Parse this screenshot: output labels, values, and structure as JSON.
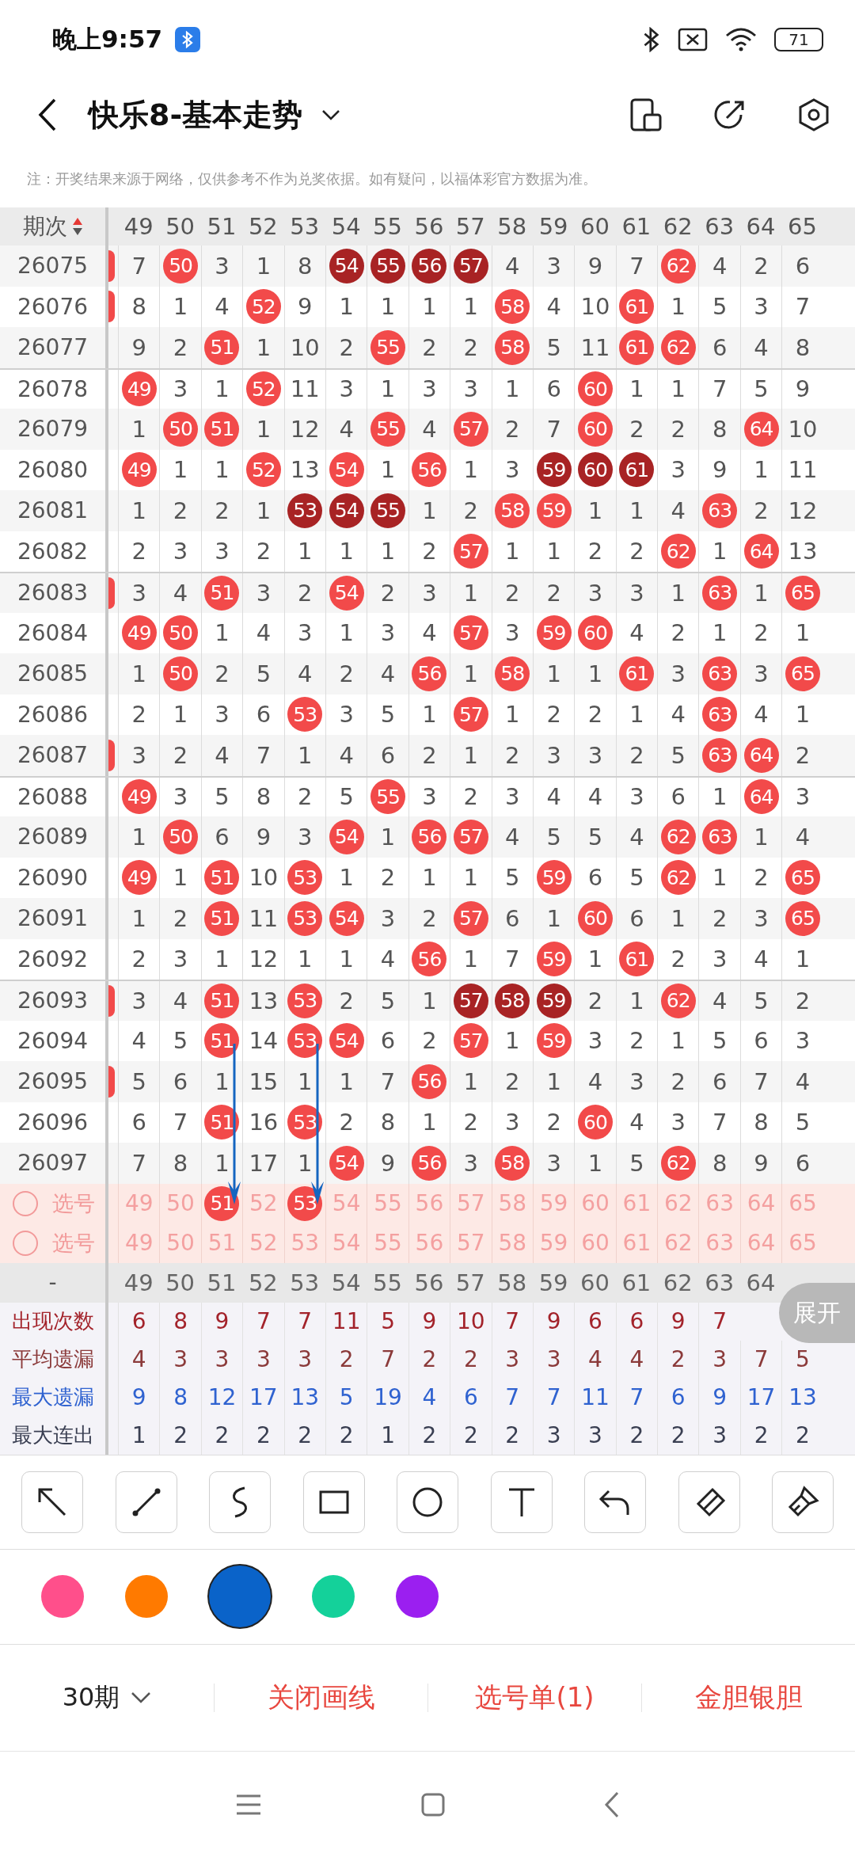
{
  "status": {
    "time": "晚上9:57",
    "battery": "71"
  },
  "title": "快乐8-基本走势",
  "note": "注：开奖结果来源于网络，仅供参考不作为兑奖依据。如有疑问，以福体彩官方数据为准。",
  "header": {
    "label": "期次",
    "numbers": [
      "49",
      "50",
      "51",
      "52",
      "53",
      "54",
      "55",
      "56",
      "57",
      "58",
      "59",
      "60",
      "61",
      "62",
      "63",
      "64",
      "65"
    ]
  },
  "rows": [
    {
      "period": "26075",
      "edge_hit": true,
      "group_start": false,
      "cells": [
        {
          "text": "7",
          "kind": "plain"
        },
        {
          "text": "50",
          "kind": "hit"
        },
        {
          "text": "3",
          "kind": "plain"
        },
        {
          "text": "1",
          "kind": "plain"
        },
        {
          "text": "8",
          "kind": "plain"
        },
        {
          "text": "54",
          "kind": "streak"
        },
        {
          "text": "55",
          "kind": "streak"
        },
        {
          "text": "56",
          "kind": "streak"
        },
        {
          "text": "57",
          "kind": "streak"
        },
        {
          "text": "4",
          "kind": "plain"
        },
        {
          "text": "3",
          "kind": "plain"
        },
        {
          "text": "9",
          "kind": "plain"
        },
        {
          "text": "7",
          "kind": "plain"
        },
        {
          "text": "62",
          "kind": "hit"
        },
        {
          "text": "4",
          "kind": "plain"
        },
        {
          "text": "2",
          "kind": "plain"
        },
        {
          "text": "6",
          "kind": "plain"
        }
      ]
    },
    {
      "period": "26076",
      "edge_hit": true,
      "group_start": false,
      "cells": [
        {
          "text": "8",
          "kind": "plain"
        },
        {
          "text": "1",
          "kind": "plain"
        },
        {
          "text": "4",
          "kind": "plain"
        },
        {
          "text": "52",
          "kind": "hit"
        },
        {
          "text": "9",
          "kind": "plain"
        },
        {
          "text": "1",
          "kind": "plain"
        },
        {
          "text": "1",
          "kind": "plain"
        },
        {
          "text": "1",
          "kind": "plain"
        },
        {
          "text": "1",
          "kind": "plain"
        },
        {
          "text": "58",
          "kind": "hit"
        },
        {
          "text": "4",
          "kind": "plain"
        },
        {
          "text": "10",
          "kind": "plain"
        },
        {
          "text": "61",
          "kind": "hit"
        },
        {
          "text": "1",
          "kind": "plain"
        },
        {
          "text": "5",
          "kind": "plain"
        },
        {
          "text": "3",
          "kind": "plain"
        },
        {
          "text": "7",
          "kind": "plain"
        }
      ]
    },
    {
      "period": "26077",
      "edge_hit": false,
      "group_start": false,
      "cells": [
        {
          "text": "9",
          "kind": "plain"
        },
        {
          "text": "2",
          "kind": "plain"
        },
        {
          "text": "51",
          "kind": "hit"
        },
        {
          "text": "1",
          "kind": "plain"
        },
        {
          "text": "10",
          "kind": "plain"
        },
        {
          "text": "2",
          "kind": "plain"
        },
        {
          "text": "55",
          "kind": "hit"
        },
        {
          "text": "2",
          "kind": "plain"
        },
        {
          "text": "2",
          "kind": "plain"
        },
        {
          "text": "58",
          "kind": "hit"
        },
        {
          "text": "5",
          "kind": "plain"
        },
        {
          "text": "11",
          "kind": "plain"
        },
        {
          "text": "61",
          "kind": "hit"
        },
        {
          "text": "62",
          "kind": "hit"
        },
        {
          "text": "6",
          "kind": "plain"
        },
        {
          "text": "4",
          "kind": "plain"
        },
        {
          "text": "8",
          "kind": "plain"
        }
      ]
    },
    {
      "period": "26078",
      "edge_hit": false,
      "group_start": true,
      "cells": [
        {
          "text": "49",
          "kind": "hit"
        },
        {
          "text": "3",
          "kind": "plain"
        },
        {
          "text": "1",
          "kind": "plain"
        },
        {
          "text": "52",
          "kind": "hit"
        },
        {
          "text": "11",
          "kind": "plain"
        },
        {
          "text": "3",
          "kind": "plain"
        },
        {
          "text": "1",
          "kind": "plain"
        },
        {
          "text": "3",
          "kind": "plain"
        },
        {
          "text": "3",
          "kind": "plain"
        },
        {
          "text": "1",
          "kind": "plain"
        },
        {
          "text": "6",
          "kind": "plain"
        },
        {
          "text": "60",
          "kind": "hit"
        },
        {
          "text": "1",
          "kind": "plain"
        },
        {
          "text": "1",
          "kind": "plain"
        },
        {
          "text": "7",
          "kind": "plain"
        },
        {
          "text": "5",
          "kind": "plain"
        },
        {
          "text": "9",
          "kind": "plain"
        }
      ]
    },
    {
      "period": "26079",
      "edge_hit": false,
      "group_start": false,
      "cells": [
        {
          "text": "1",
          "kind": "plain"
        },
        {
          "text": "50",
          "kind": "hit"
        },
        {
          "text": "51",
          "kind": "hit"
        },
        {
          "text": "1",
          "kind": "plain"
        },
        {
          "text": "12",
          "kind": "plain"
        },
        {
          "text": "4",
          "kind": "plain"
        },
        {
          "text": "55",
          "kind": "hit"
        },
        {
          "text": "4",
          "kind": "plain"
        },
        {
          "text": "57",
          "kind": "hit"
        },
        {
          "text": "2",
          "kind": "plain"
        },
        {
          "text": "7",
          "kind": "plain"
        },
        {
          "text": "60",
          "kind": "hit"
        },
        {
          "text": "2",
          "kind": "plain"
        },
        {
          "text": "2",
          "kind": "plain"
        },
        {
          "text": "8",
          "kind": "plain"
        },
        {
          "text": "64",
          "kind": "hit"
        },
        {
          "text": "10",
          "kind": "plain"
        }
      ]
    },
    {
      "period": "26080",
      "edge_hit": false,
      "group_start": false,
      "cells": [
        {
          "text": "49",
          "kind": "hit"
        },
        {
          "text": "1",
          "kind": "plain"
        },
        {
          "text": "1",
          "kind": "plain"
        },
        {
          "text": "52",
          "kind": "hit"
        },
        {
          "text": "13",
          "kind": "plain"
        },
        {
          "text": "54",
          "kind": "hit"
        },
        {
          "text": "1",
          "kind": "plain"
        },
        {
          "text": "56",
          "kind": "hit"
        },
        {
          "text": "1",
          "kind": "plain"
        },
        {
          "text": "3",
          "kind": "plain"
        },
        {
          "text": "59",
          "kind": "streak"
        },
        {
          "text": "60",
          "kind": "streak"
        },
        {
          "text": "61",
          "kind": "streak"
        },
        {
          "text": "3",
          "kind": "plain"
        },
        {
          "text": "9",
          "kind": "plain"
        },
        {
          "text": "1",
          "kind": "plain"
        },
        {
          "text": "11",
          "kind": "plain"
        }
      ]
    },
    {
      "period": "26081",
      "edge_hit": false,
      "group_start": false,
      "cells": [
        {
          "text": "1",
          "kind": "plain"
        },
        {
          "text": "2",
          "kind": "plain"
        },
        {
          "text": "2",
          "kind": "plain"
        },
        {
          "text": "1",
          "kind": "plain"
        },
        {
          "text": "53",
          "kind": "streak"
        },
        {
          "text": "54",
          "kind": "streak"
        },
        {
          "text": "55",
          "kind": "streak"
        },
        {
          "text": "1",
          "kind": "plain"
        },
        {
          "text": "2",
          "kind": "plain"
        },
        {
          "text": "58",
          "kind": "hit"
        },
        {
          "text": "59",
          "kind": "hit"
        },
        {
          "text": "1",
          "kind": "plain"
        },
        {
          "text": "1",
          "kind": "plain"
        },
        {
          "text": "4",
          "kind": "plain"
        },
        {
          "text": "63",
          "kind": "hit"
        },
        {
          "text": "2",
          "kind": "plain"
        },
        {
          "text": "12",
          "kind": "plain"
        }
      ]
    },
    {
      "period": "26082",
      "edge_hit": false,
      "group_start": false,
      "cells": [
        {
          "text": "2",
          "kind": "plain"
        },
        {
          "text": "3",
          "kind": "plain"
        },
        {
          "text": "3",
          "kind": "plain"
        },
        {
          "text": "2",
          "kind": "plain"
        },
        {
          "text": "1",
          "kind": "plain"
        },
        {
          "text": "1",
          "kind": "plain"
        },
        {
          "text": "1",
          "kind": "plain"
        },
        {
          "text": "2",
          "kind": "plain"
        },
        {
          "text": "57",
          "kind": "hit"
        },
        {
          "text": "1",
          "kind": "plain"
        },
        {
          "text": "1",
          "kind": "plain"
        },
        {
          "text": "2",
          "kind": "plain"
        },
        {
          "text": "2",
          "kind": "plain"
        },
        {
          "text": "62",
          "kind": "hit"
        },
        {
          "text": "1",
          "kind": "plain"
        },
        {
          "text": "64",
          "kind": "hit"
        },
        {
          "text": "13",
          "kind": "plain"
        }
      ]
    },
    {
      "period": "26083",
      "edge_hit": true,
      "group_start": true,
      "cells": [
        {
          "text": "3",
          "kind": "plain"
        },
        {
          "text": "4",
          "kind": "plain"
        },
        {
          "text": "51",
          "kind": "hit"
        },
        {
          "text": "3",
          "kind": "plain"
        },
        {
          "text": "2",
          "kind": "plain"
        },
        {
          "text": "54",
          "kind": "hit"
        },
        {
          "text": "2",
          "kind": "plain"
        },
        {
          "text": "3",
          "kind": "plain"
        },
        {
          "text": "1",
          "kind": "plain"
        },
        {
          "text": "2",
          "kind": "plain"
        },
        {
          "text": "2",
          "kind": "plain"
        },
        {
          "text": "3",
          "kind": "plain"
        },
        {
          "text": "3",
          "kind": "plain"
        },
        {
          "text": "1",
          "kind": "plain"
        },
        {
          "text": "63",
          "kind": "hit"
        },
        {
          "text": "1",
          "kind": "plain"
        },
        {
          "text": "65",
          "kind": "hit"
        }
      ]
    },
    {
      "period": "26084",
      "edge_hit": false,
      "group_start": false,
      "cells": [
        {
          "text": "49",
          "kind": "hit"
        },
        {
          "text": "50",
          "kind": "hit"
        },
        {
          "text": "1",
          "kind": "plain"
        },
        {
          "text": "4",
          "kind": "plain"
        },
        {
          "text": "3",
          "kind": "plain"
        },
        {
          "text": "1",
          "kind": "plain"
        },
        {
          "text": "3",
          "kind": "plain"
        },
        {
          "text": "4",
          "kind": "plain"
        },
        {
          "text": "57",
          "kind": "hit"
        },
        {
          "text": "3",
          "kind": "plain"
        },
        {
          "text": "59",
          "kind": "hit"
        },
        {
          "text": "60",
          "kind": "hit"
        },
        {
          "text": "4",
          "kind": "plain"
        },
        {
          "text": "2",
          "kind": "plain"
        },
        {
          "text": "1",
          "kind": "plain"
        },
        {
          "text": "2",
          "kind": "plain"
        },
        {
          "text": "1",
          "kind": "plain"
        }
      ]
    },
    {
      "period": "26085",
      "edge_hit": false,
      "group_start": false,
      "cells": [
        {
          "text": "1",
          "kind": "plain"
        },
        {
          "text": "50",
          "kind": "hit"
        },
        {
          "text": "2",
          "kind": "plain"
        },
        {
          "text": "5",
          "kind": "plain"
        },
        {
          "text": "4",
          "kind": "plain"
        },
        {
          "text": "2",
          "kind": "plain"
        },
        {
          "text": "4",
          "kind": "plain"
        },
        {
          "text": "56",
          "kind": "hit"
        },
        {
          "text": "1",
          "kind": "plain"
        },
        {
          "text": "58",
          "kind": "hit"
        },
        {
          "text": "1",
          "kind": "plain"
        },
        {
          "text": "1",
          "kind": "plain"
        },
        {
          "text": "61",
          "kind": "hit"
        },
        {
          "text": "3",
          "kind": "plain"
        },
        {
          "text": "63",
          "kind": "hit"
        },
        {
          "text": "3",
          "kind": "plain"
        },
        {
          "text": "65",
          "kind": "hit"
        }
      ]
    },
    {
      "period": "26086",
      "edge_hit": false,
      "group_start": false,
      "cells": [
        {
          "text": "2",
          "kind": "plain"
        },
        {
          "text": "1",
          "kind": "plain"
        },
        {
          "text": "3",
          "kind": "plain"
        },
        {
          "text": "6",
          "kind": "plain"
        },
        {
          "text": "53",
          "kind": "hit"
        },
        {
          "text": "3",
          "kind": "plain"
        },
        {
          "text": "5",
          "kind": "plain"
        },
        {
          "text": "1",
          "kind": "plain"
        },
        {
          "text": "57",
          "kind": "hit"
        },
        {
          "text": "1",
          "kind": "plain"
        },
        {
          "text": "2",
          "kind": "plain"
        },
        {
          "text": "2",
          "kind": "plain"
        },
        {
          "text": "1",
          "kind": "plain"
        },
        {
          "text": "4",
          "kind": "plain"
        },
        {
          "text": "63",
          "kind": "hit"
        },
        {
          "text": "4",
          "kind": "plain"
        },
        {
          "text": "1",
          "kind": "plain"
        }
      ]
    },
    {
      "period": "26087",
      "edge_hit": true,
      "group_start": false,
      "cells": [
        {
          "text": "3",
          "kind": "plain"
        },
        {
          "text": "2",
          "kind": "plain"
        },
        {
          "text": "4",
          "kind": "plain"
        },
        {
          "text": "7",
          "kind": "plain"
        },
        {
          "text": "1",
          "kind": "plain"
        },
        {
          "text": "4",
          "kind": "plain"
        },
        {
          "text": "6",
          "kind": "plain"
        },
        {
          "text": "2",
          "kind": "plain"
        },
        {
          "text": "1",
          "kind": "plain"
        },
        {
          "text": "2",
          "kind": "plain"
        },
        {
          "text": "3",
          "kind": "plain"
        },
        {
          "text": "3",
          "kind": "plain"
        },
        {
          "text": "2",
          "kind": "plain"
        },
        {
          "text": "5",
          "kind": "plain"
        },
        {
          "text": "63",
          "kind": "hit"
        },
        {
          "text": "64",
          "kind": "hit"
        },
        {
          "text": "2",
          "kind": "plain"
        }
      ]
    },
    {
      "period": "26088",
      "edge_hit": false,
      "group_start": true,
      "cells": [
        {
          "text": "49",
          "kind": "hit"
        },
        {
          "text": "3",
          "kind": "plain"
        },
        {
          "text": "5",
          "kind": "plain"
        },
        {
          "text": "8",
          "kind": "plain"
        },
        {
          "text": "2",
          "kind": "plain"
        },
        {
          "text": "5",
          "kind": "plain"
        },
        {
          "text": "55",
          "kind": "hit"
        },
        {
          "text": "3",
          "kind": "plain"
        },
        {
          "text": "2",
          "kind": "plain"
        },
        {
          "text": "3",
          "kind": "plain"
        },
        {
          "text": "4",
          "kind": "plain"
        },
        {
          "text": "4",
          "kind": "plain"
        },
        {
          "text": "3",
          "kind": "plain"
        },
        {
          "text": "6",
          "kind": "plain"
        },
        {
          "text": "1",
          "kind": "plain"
        },
        {
          "text": "64",
          "kind": "hit"
        },
        {
          "text": "3",
          "kind": "plain"
        }
      ]
    },
    {
      "period": "26089",
      "edge_hit": false,
      "group_start": false,
      "cells": [
        {
          "text": "1",
          "kind": "plain"
        },
        {
          "text": "50",
          "kind": "hit"
        },
        {
          "text": "6",
          "kind": "plain"
        },
        {
          "text": "9",
          "kind": "plain"
        },
        {
          "text": "3",
          "kind": "plain"
        },
        {
          "text": "54",
          "kind": "hit"
        },
        {
          "text": "1",
          "kind": "plain"
        },
        {
          "text": "56",
          "kind": "hit"
        },
        {
          "text": "57",
          "kind": "hit"
        },
        {
          "text": "4",
          "kind": "plain"
        },
        {
          "text": "5",
          "kind": "plain"
        },
        {
          "text": "5",
          "kind": "plain"
        },
        {
          "text": "4",
          "kind": "plain"
        },
        {
          "text": "62",
          "kind": "hit"
        },
        {
          "text": "63",
          "kind": "hit"
        },
        {
          "text": "1",
          "kind": "plain"
        },
        {
          "text": "4",
          "kind": "plain"
        }
      ]
    },
    {
      "period": "26090",
      "edge_hit": false,
      "group_start": false,
      "cells": [
        {
          "text": "49",
          "kind": "hit"
        },
        {
          "text": "1",
          "kind": "plain"
        },
        {
          "text": "51",
          "kind": "hit"
        },
        {
          "text": "10",
          "kind": "plain"
        },
        {
          "text": "53",
          "kind": "hit"
        },
        {
          "text": "1",
          "kind": "plain"
        },
        {
          "text": "2",
          "kind": "plain"
        },
        {
          "text": "1",
          "kind": "plain"
        },
        {
          "text": "1",
          "kind": "plain"
        },
        {
          "text": "5",
          "kind": "plain"
        },
        {
          "text": "59",
          "kind": "hit"
        },
        {
          "text": "6",
          "kind": "plain"
        },
        {
          "text": "5",
          "kind": "plain"
        },
        {
          "text": "62",
          "kind": "hit"
        },
        {
          "text": "1",
          "kind": "plain"
        },
        {
          "text": "2",
          "kind": "plain"
        },
        {
          "text": "65",
          "kind": "hit"
        }
      ]
    },
    {
      "period": "26091",
      "edge_hit": false,
      "group_start": false,
      "cells": [
        {
          "text": "1",
          "kind": "plain"
        },
        {
          "text": "2",
          "kind": "plain"
        },
        {
          "text": "51",
          "kind": "hit"
        },
        {
          "text": "11",
          "kind": "plain"
        },
        {
          "text": "53",
          "kind": "hit"
        },
        {
          "text": "54",
          "kind": "hit"
        },
        {
          "text": "3",
          "kind": "plain"
        },
        {
          "text": "2",
          "kind": "plain"
        },
        {
          "text": "57",
          "kind": "hit"
        },
        {
          "text": "6",
          "kind": "plain"
        },
        {
          "text": "1",
          "kind": "plain"
        },
        {
          "text": "60",
          "kind": "hit"
        },
        {
          "text": "6",
          "kind": "plain"
        },
        {
          "text": "1",
          "kind": "plain"
        },
        {
          "text": "2",
          "kind": "plain"
        },
        {
          "text": "3",
          "kind": "plain"
        },
        {
          "text": "65",
          "kind": "hit"
        }
      ]
    },
    {
      "period": "26092",
      "edge_hit": false,
      "group_start": false,
      "cells": [
        {
          "text": "2",
          "kind": "plain"
        },
        {
          "text": "3",
          "kind": "plain"
        },
        {
          "text": "1",
          "kind": "plain"
        },
        {
          "text": "12",
          "kind": "plain"
        },
        {
          "text": "1",
          "kind": "plain"
        },
        {
          "text": "1",
          "kind": "plain"
        },
        {
          "text": "4",
          "kind": "plain"
        },
        {
          "text": "56",
          "kind": "hit"
        },
        {
          "text": "1",
          "kind": "plain"
        },
        {
          "text": "7",
          "kind": "plain"
        },
        {
          "text": "59",
          "kind": "hit"
        },
        {
          "text": "1",
          "kind": "plain"
        },
        {
          "text": "61",
          "kind": "hit"
        },
        {
          "text": "2",
          "kind": "plain"
        },
        {
          "text": "3",
          "kind": "plain"
        },
        {
          "text": "4",
          "kind": "plain"
        },
        {
          "text": "1",
          "kind": "plain"
        }
      ]
    },
    {
      "period": "26093",
      "edge_hit": true,
      "group_start": true,
      "cells": [
        {
          "text": "3",
          "kind": "plain"
        },
        {
          "text": "4",
          "kind": "plain"
        },
        {
          "text": "51",
          "kind": "hit"
        },
        {
          "text": "13",
          "kind": "plain"
        },
        {
          "text": "53",
          "kind": "hit"
        },
        {
          "text": "2",
          "kind": "plain"
        },
        {
          "text": "5",
          "kind": "plain"
        },
        {
          "text": "1",
          "kind": "plain"
        },
        {
          "text": "57",
          "kind": "streak"
        },
        {
          "text": "58",
          "kind": "streak"
        },
        {
          "text": "59",
          "kind": "streak"
        },
        {
          "text": "2",
          "kind": "plain"
        },
        {
          "text": "1",
          "kind": "plain"
        },
        {
          "text": "62",
          "kind": "hit"
        },
        {
          "text": "4",
          "kind": "plain"
        },
        {
          "text": "5",
          "kind": "plain"
        },
        {
          "text": "2",
          "kind": "plain"
        }
      ]
    },
    {
      "period": "26094",
      "edge_hit": false,
      "group_start": false,
      "cells": [
        {
          "text": "4",
          "kind": "plain"
        },
        {
          "text": "5",
          "kind": "plain"
        },
        {
          "text": "51",
          "kind": "arrow"
        },
        {
          "text": "14",
          "kind": "plain"
        },
        {
          "text": "53",
          "kind": "arrow"
        },
        {
          "text": "54",
          "kind": "hit"
        },
        {
          "text": "6",
          "kind": "plain"
        },
        {
          "text": "2",
          "kind": "plain"
        },
        {
          "text": "57",
          "kind": "hit"
        },
        {
          "text": "1",
          "kind": "plain"
        },
        {
          "text": "59",
          "kind": "hit"
        },
        {
          "text": "3",
          "kind": "plain"
        },
        {
          "text": "2",
          "kind": "plain"
        },
        {
          "text": "1",
          "kind": "plain"
        },
        {
          "text": "5",
          "kind": "plain"
        },
        {
          "text": "6",
          "kind": "plain"
        },
        {
          "text": "3",
          "kind": "plain"
        }
      ]
    },
    {
      "period": "26095",
      "edge_hit": true,
      "group_start": false,
      "cells": [
        {
          "text": "5",
          "kind": "plain"
        },
        {
          "text": "6",
          "kind": "plain"
        },
        {
          "text": "1",
          "kind": "plain"
        },
        {
          "text": "15",
          "kind": "plain"
        },
        {
          "text": "1",
          "kind": "plain"
        },
        {
          "text": "1",
          "kind": "plain"
        },
        {
          "text": "7",
          "kind": "plain"
        },
        {
          "text": "56",
          "kind": "hit"
        },
        {
          "text": "1",
          "kind": "plain"
        },
        {
          "text": "2",
          "kind": "plain"
        },
        {
          "text": "1",
          "kind": "plain"
        },
        {
          "text": "4",
          "kind": "plain"
        },
        {
          "text": "3",
          "kind": "plain"
        },
        {
          "text": "2",
          "kind": "plain"
        },
        {
          "text": "6",
          "kind": "plain"
        },
        {
          "text": "7",
          "kind": "plain"
        },
        {
          "text": "4",
          "kind": "plain"
        }
      ]
    },
    {
      "period": "26096",
      "edge_hit": false,
      "group_start": false,
      "cells": [
        {
          "text": "6",
          "kind": "plain"
        },
        {
          "text": "7",
          "kind": "plain"
        },
        {
          "text": "51",
          "kind": "hit"
        },
        {
          "text": "16",
          "kind": "plain"
        },
        {
          "text": "53",
          "kind": "hit"
        },
        {
          "text": "2",
          "kind": "plain"
        },
        {
          "text": "8",
          "kind": "plain"
        },
        {
          "text": "1",
          "kind": "plain"
        },
        {
          "text": "2",
          "kind": "plain"
        },
        {
          "text": "3",
          "kind": "plain"
        },
        {
          "text": "2",
          "kind": "plain"
        },
        {
          "text": "60",
          "kind": "hit"
        },
        {
          "text": "4",
          "kind": "plain"
        },
        {
          "text": "3",
          "kind": "plain"
        },
        {
          "text": "7",
          "kind": "plain"
        },
        {
          "text": "8",
          "kind": "plain"
        },
        {
          "text": "5",
          "kind": "plain"
        }
      ]
    },
    {
      "period": "26097",
      "edge_hit": false,
      "group_start": false,
      "cells": [
        {
          "text": "7",
          "kind": "plain"
        },
        {
          "text": "8",
          "kind": "plain"
        },
        {
          "text": "1",
          "kind": "plain"
        },
        {
          "text": "17",
          "kind": "plain"
        },
        {
          "text": "1",
          "kind": "plain"
        },
        {
          "text": "54",
          "kind": "hit"
        },
        {
          "text": "9",
          "kind": "plain"
        },
        {
          "text": "56",
          "kind": "hit"
        },
        {
          "text": "3",
          "kind": "plain"
        },
        {
          "text": "58",
          "kind": "hit"
        },
        {
          "text": "3",
          "kind": "plain"
        },
        {
          "text": "1",
          "kind": "plain"
        },
        {
          "text": "5",
          "kind": "plain"
        },
        {
          "text": "62",
          "kind": "hit"
        },
        {
          "text": "8",
          "kind": "plain"
        },
        {
          "text": "9",
          "kind": "plain"
        },
        {
          "text": "6",
          "kind": "plain"
        }
      ]
    }
  ],
  "pick_rows": [
    {
      "label": "选号",
      "checked": false,
      "numbers": [
        {
          "text": "49",
          "selected": false
        },
        {
          "text": "50",
          "selected": false
        },
        {
          "text": "51",
          "selected": true
        },
        {
          "text": "52",
          "selected": false
        },
        {
          "text": "53",
          "selected": true
        },
        {
          "text": "54",
          "selected": false
        },
        {
          "text": "55",
          "selected": false
        },
        {
          "text": "56",
          "selected": false
        },
        {
          "text": "57",
          "selected": false
        },
        {
          "text": "58",
          "selected": false
        },
        {
          "text": "59",
          "selected": false
        },
        {
          "text": "60",
          "selected": false
        },
        {
          "text": "61",
          "selected": false
        },
        {
          "text": "62",
          "selected": false
        },
        {
          "text": "63",
          "selected": false
        },
        {
          "text": "64",
          "selected": false
        },
        {
          "text": "65",
          "selected": false
        }
      ]
    },
    {
      "label": "选号",
      "checked": false,
      "numbers": [
        {
          "text": "49",
          "selected": false
        },
        {
          "text": "50",
          "selected": false
        },
        {
          "text": "51",
          "selected": false
        },
        {
          "text": "52",
          "selected": false
        },
        {
          "text": "53",
          "selected": false
        },
        {
          "text": "54",
          "selected": false
        },
        {
          "text": "55",
          "selected": false
        },
        {
          "text": "56",
          "selected": false
        },
        {
          "text": "57",
          "selected": false
        },
        {
          "text": "58",
          "selected": false
        },
        {
          "text": "59",
          "selected": false
        },
        {
          "text": "60",
          "selected": false
        },
        {
          "text": "61",
          "selected": false
        },
        {
          "text": "62",
          "selected": false
        },
        {
          "text": "63",
          "selected": false
        },
        {
          "text": "64",
          "selected": false
        },
        {
          "text": "65",
          "selected": false
        }
      ]
    }
  ],
  "footer_header": {
    "label": "-",
    "numbers": [
      "49",
      "50",
      "51",
      "52",
      "53",
      "54",
      "55",
      "56",
      "57",
      "58",
      "59",
      "60",
      "61",
      "62",
      "63",
      "64"
    ]
  },
  "stats": [
    {
      "label": "出现次数",
      "kind": "count",
      "values": [
        "6",
        "8",
        "9",
        "7",
        "7",
        "11",
        "5",
        "9",
        "10",
        "7",
        "9",
        "6",
        "6",
        "9",
        "7"
      ]
    },
    {
      "label": "平均遗漏",
      "kind": "average",
      "values": [
        "4",
        "3",
        "3",
        "3",
        "3",
        "2",
        "7",
        "2",
        "2",
        "3",
        "3",
        "4",
        "4",
        "2",
        "3",
        "7",
        "5"
      ]
    },
    {
      "label": "最大遗漏",
      "kind": "max_miss",
      "values": [
        "9",
        "8",
        "12",
        "17",
        "13",
        "5",
        "19",
        "4",
        "6",
        "7",
        "7",
        "11",
        "7",
        "6",
        "9",
        "17",
        "13"
      ]
    },
    {
      "label": "最大连出",
      "kind": "max_streak",
      "values": [
        "1",
        "2",
        "2",
        "2",
        "2",
        "2",
        "1",
        "2",
        "2",
        "2",
        "3",
        "3",
        "2",
        "2",
        "3",
        "2",
        "2"
      ]
    }
  ],
  "expand_button": "展开",
  "colors": [
    {
      "color": "#ff4f8b",
      "selected": false
    },
    {
      "color": "#ff7a00",
      "selected": false
    },
    {
      "color": "#0a63c9",
      "selected": true
    },
    {
      "color": "#14d19a",
      "selected": false
    },
    {
      "color": "#9b1ff0",
      "selected": false
    }
  ],
  "bottom_bar": {
    "period": "30期",
    "actions": [
      "关闭画线",
      "选号单(1)",
      "金胆银胆"
    ]
  }
}
